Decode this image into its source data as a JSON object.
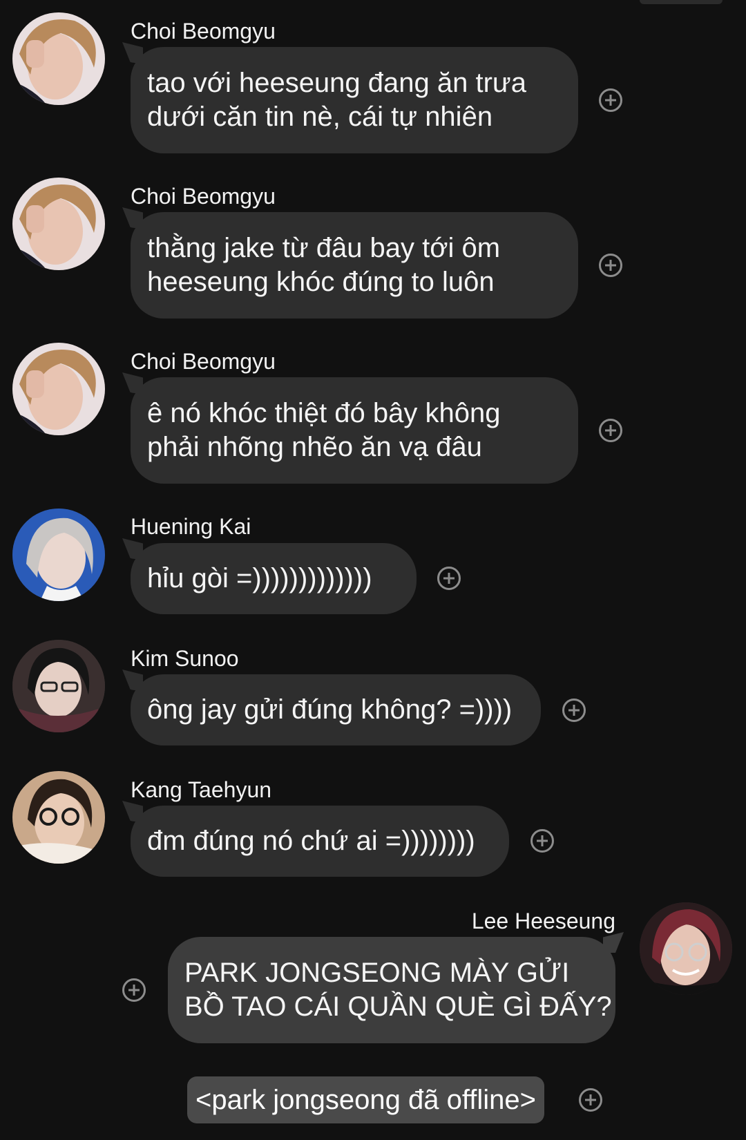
{
  "messages": [
    {
      "sender": "Choi Beomgyu",
      "lines": [
        "tao với heeseung đang ăn trưa",
        "dưới căn tin nè, cái tự nhiên"
      ],
      "avatar_icon": "avatar-beomgyu"
    },
    {
      "sender": "Choi Beomgyu",
      "lines": [
        "thằng jake từ đâu bay tới ôm",
        "heeseung khóc đúng to luôn"
      ],
      "avatar_icon": "avatar-beomgyu"
    },
    {
      "sender": "Choi Beomgyu",
      "lines": [
        "ê nó khóc thiệt đó bây không",
        "phải nhõng nhẽo ăn vạ đâu"
      ],
      "avatar_icon": "avatar-beomgyu"
    },
    {
      "sender": "Huening Kai",
      "lines": [
        "hỉu gòi =)))))))))))))"
      ],
      "avatar_icon": "avatar-huening-kai"
    },
    {
      "sender": "Kim Sunoo",
      "lines": [
        "ông jay gửi đúng không? =))))"
      ],
      "avatar_icon": "avatar-sunoo"
    },
    {
      "sender": "Kang Taehyun",
      "lines": [
        "đm đúng nó chứ ai =))))))))"
      ],
      "avatar_icon": "avatar-taehyun"
    },
    {
      "sender": "Lee Heeseung",
      "lines": [
        "PARK JONGSEONG MÀY GỬI",
        "BỒ TAO CÁI QUẦN QUÈ GÌ ĐẤY?"
      ],
      "avatar_icon": "avatar-heeseung",
      "own": true
    }
  ],
  "system_message": "<park jongseong đã offline>",
  "colors": {
    "background": "#111111",
    "bubble_other": "#2e2e2e",
    "bubble_own": "#3d3d3d",
    "system_bubble": "#4a4a4a",
    "react_icon": "#8c8c8c"
  }
}
